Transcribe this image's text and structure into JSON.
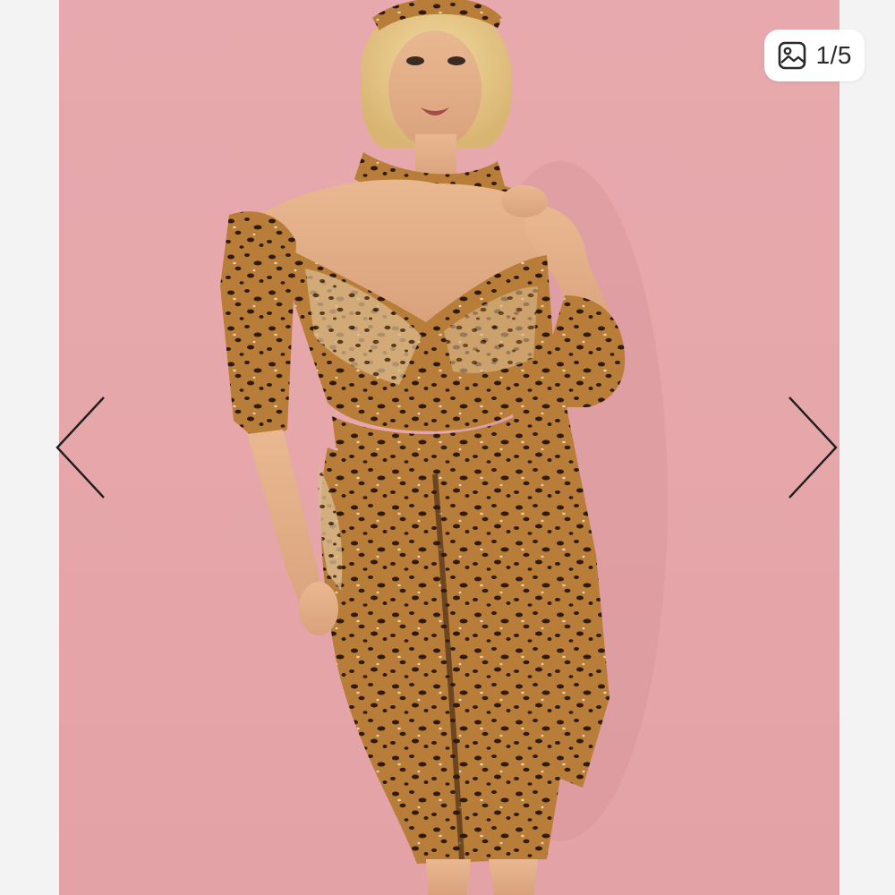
{
  "viewer": {
    "counter": "1/5",
    "counter_icon": "image-gallery-icon",
    "prev_icon": "chevron-left-icon",
    "next_icon": "chevron-right-icon",
    "background_color": "#e6a7aa",
    "print_colors": [
      "#b67a36",
      "#3a2414",
      "#f0e0c8"
    ]
  }
}
